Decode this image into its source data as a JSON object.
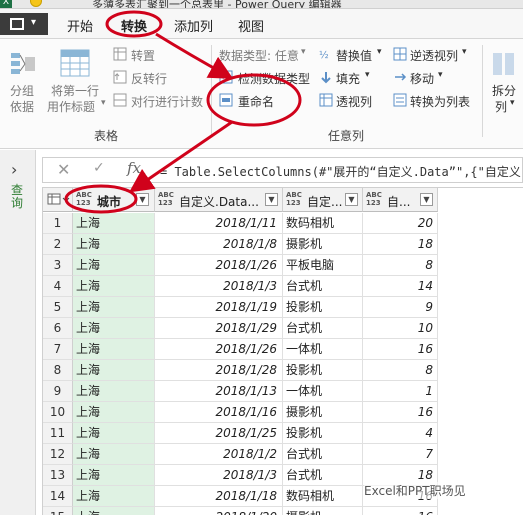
{
  "titlebar": {
    "title": "多薄多表汇聚到一个总表里 - Power Query 编辑器"
  },
  "tabs": [
    "开始",
    "转换",
    "添加列",
    "视图"
  ],
  "ribbon": {
    "group_col": {
      "line1": "分组",
      "line2": "依据"
    },
    "use_first_row": {
      "line1": "将第一行",
      "line2": "用作标题"
    },
    "transpose": "转置",
    "reverse_rows": "反转行",
    "count_rows": "对行进行计数",
    "table_group_label": "表格",
    "data_type": "数据类型: 任意",
    "detect_type": "检测数据类型",
    "rename": "重命名",
    "replace_values": "替换值",
    "fill": "填充",
    "pivot_column": "透视列",
    "unpivot": "逆透视列",
    "move": "移动",
    "convert_to_list": "转换为列表",
    "any_column_label": "任意列",
    "split": {
      "line1": "拆分",
      "line2": "列"
    }
  },
  "left_pane": {
    "label": "查询"
  },
  "formula_bar": {
    "fx": "fx",
    "formula": "= Table.SelectColumns(#\"展开的“自定义.Data”\",{\"自定义.Da"
  },
  "columns": [
    {
      "type": "ABC\n123",
      "name": "城市"
    },
    {
      "type": "ABC\n123",
      "name": "自定义.Data..."
    },
    {
      "type": "ABC\n123",
      "name": "自定..."
    },
    {
      "type": "ABC\n123",
      "name": "自..."
    }
  ],
  "rows": [
    [
      "1",
      "上海",
      "2018/1/11",
      "数码相机",
      "20"
    ],
    [
      "2",
      "上海",
      "2018/1/8",
      "摄影机",
      "18"
    ],
    [
      "3",
      "上海",
      "2018/1/26",
      "平板电脑",
      "8"
    ],
    [
      "4",
      "上海",
      "2018/1/3",
      "台式机",
      "14"
    ],
    [
      "5",
      "上海",
      "2018/1/19",
      "投影机",
      "9"
    ],
    [
      "6",
      "上海",
      "2018/1/29",
      "台式机",
      "10"
    ],
    [
      "7",
      "上海",
      "2018/1/26",
      "一体机",
      "16"
    ],
    [
      "8",
      "上海",
      "2018/1/28",
      "投影机",
      "8"
    ],
    [
      "9",
      "上海",
      "2018/1/13",
      "一体机",
      "1"
    ],
    [
      "10",
      "上海",
      "2018/1/16",
      "摄影机",
      "16"
    ],
    [
      "11",
      "上海",
      "2018/1/25",
      "投影机",
      "4"
    ],
    [
      "12",
      "上海",
      "2018/1/2",
      "台式机",
      "7"
    ],
    [
      "13",
      "上海",
      "2018/1/3",
      "台式机",
      "18"
    ],
    [
      "14",
      "上海",
      "2018/1/18",
      "数码相机",
      "16"
    ],
    [
      "15",
      "上海",
      "2018/1/20",
      "摄影机",
      "16"
    ]
  ],
  "watermark": "Excel和PPT职场见",
  "colors": {
    "annotation": "#d0021b",
    "city_highlight": "#dff2e3"
  }
}
